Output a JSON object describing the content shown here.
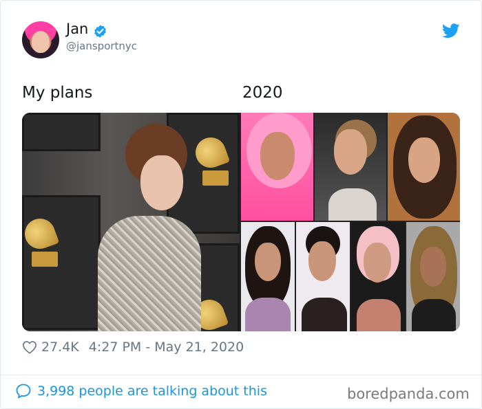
{
  "author": {
    "name": "Jan",
    "handle": "@jansportnyc",
    "avatar": "avatar-photo",
    "verified_icon": "verified-badge-icon"
  },
  "captions": {
    "left": "My plans",
    "right": "2020"
  },
  "media": {
    "main_image": "woman-at-grammys-photo",
    "grid": [
      "portrait-pink-hair",
      "portrait-ponytail",
      "portrait-curly-hair",
      "portrait-black-hair",
      "portrait-slicked-ponytail",
      "portrait-pink-blonde-hair",
      "portrait-curly-blonde-hair"
    ]
  },
  "footer": {
    "likes": "27.4K",
    "timestamp": "4:27 PM - May 21, 2020",
    "talking": "3,998 people are talking about this"
  },
  "watermark": "boredpanda.com",
  "colors": {
    "twitter_blue": "#1da1f2",
    "link_blue": "#1b95e0",
    "secondary_text": "#657786",
    "border": "#e1e8ed"
  }
}
